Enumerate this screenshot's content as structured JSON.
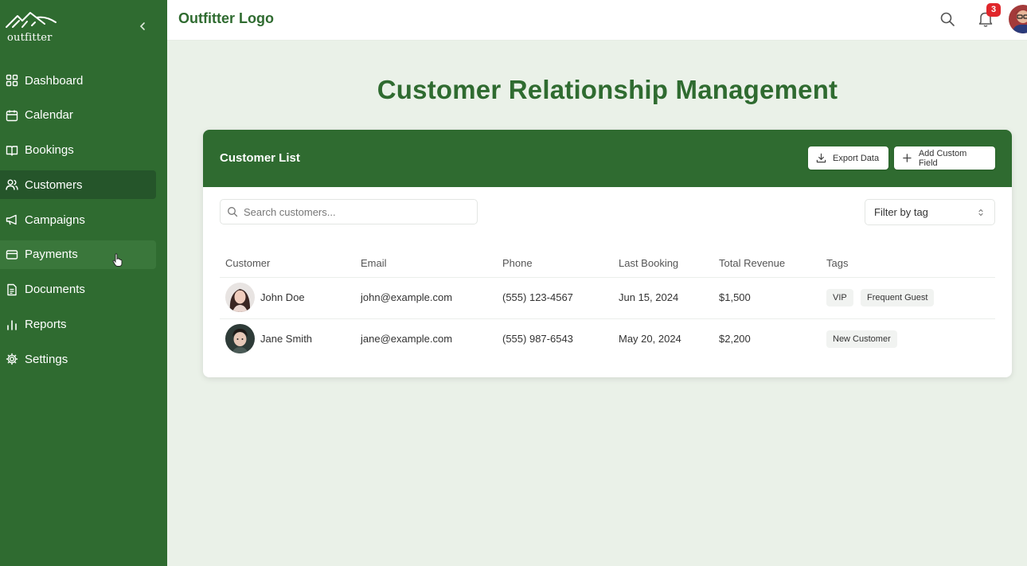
{
  "sidebar": {
    "brand": "outfitter",
    "collapse_icon": "chevron-left-icon",
    "items": [
      {
        "label": "Dashboard",
        "icon": "grid-icon"
      },
      {
        "label": "Calendar",
        "icon": "calendar-icon"
      },
      {
        "label": "Bookings",
        "icon": "book-icon"
      },
      {
        "label": "Customers",
        "icon": "users-icon",
        "active": true
      },
      {
        "label": "Campaigns",
        "icon": "megaphone-icon"
      },
      {
        "label": "Payments",
        "icon": "credit-card-icon"
      },
      {
        "label": "Documents",
        "icon": "document-icon"
      },
      {
        "label": "Reports",
        "icon": "bar-chart-icon"
      },
      {
        "label": "Settings",
        "icon": "gear-icon"
      }
    ]
  },
  "header": {
    "title": "Outfitter Logo",
    "notification_count": "3"
  },
  "main": {
    "title": "Customer Relationship Management"
  },
  "card": {
    "title": "Customer List",
    "export_label": "Export Data",
    "add_field_label": "Add Custom Field",
    "search_placeholder": "Search customers...",
    "filter_label": "Filter by tag",
    "columns": [
      "Customer",
      "Email",
      "Phone",
      "Last Booking",
      "Total Revenue",
      "Tags"
    ],
    "rows": [
      {
        "name": "John Doe",
        "email": "john@example.com",
        "phone": "(555) 123-4567",
        "last_booking": "Jun 15, 2024",
        "revenue": "$1,500",
        "tags": [
          "VIP",
          "Frequent Guest"
        ]
      },
      {
        "name": "Jane Smith",
        "email": "jane@example.com",
        "phone": "(555) 987-6543",
        "last_booking": "May 20, 2024",
        "revenue": "$2,200",
        "tags": [
          "New Customer"
        ]
      }
    ]
  },
  "colors": {
    "brand_green": "#2f6b30",
    "active_nav": "#25552a",
    "page_bg": "#eaf1e8",
    "badge_red": "#e0262b"
  }
}
